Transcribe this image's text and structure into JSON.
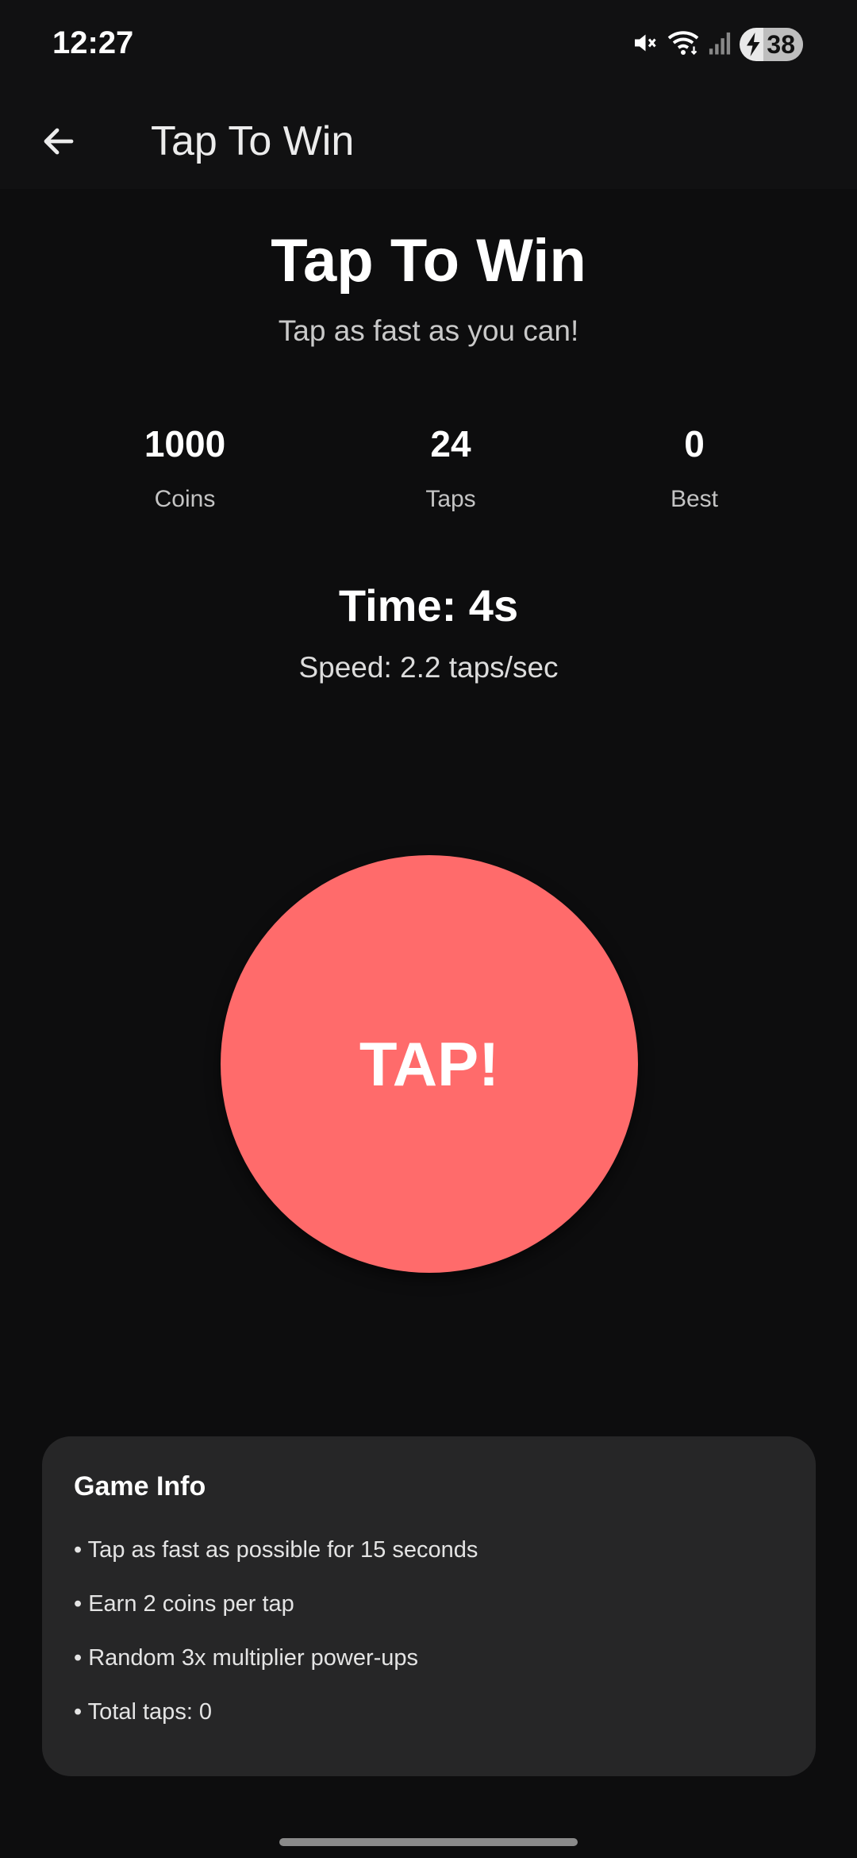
{
  "status_bar": {
    "time": "12:27",
    "battery_level": "38",
    "icons": [
      "mute-icon",
      "wifi-icon",
      "signal-icon",
      "battery-charging-icon"
    ]
  },
  "app_bar": {
    "title": "Tap To Win",
    "back_icon": "arrow-left-icon"
  },
  "game": {
    "title": "Tap To Win",
    "subtitle": "Tap as fast as you can!",
    "stats": [
      {
        "value": "1000",
        "label": "Coins"
      },
      {
        "value": "24",
        "label": "Taps"
      },
      {
        "value": "0",
        "label": "Best"
      }
    ],
    "time": "Time: 4s",
    "speed": "Speed: 2.2 taps/sec",
    "tap_label": "TAP!",
    "tap_color": "#ff6b6b"
  },
  "info": {
    "title": "Game Info",
    "items": [
      "• Tap as fast as possible for 15 seconds",
      "• Earn 2 coins per tap",
      "• Random 3x multiplier power-ups",
      "• Total taps: 0"
    ]
  }
}
